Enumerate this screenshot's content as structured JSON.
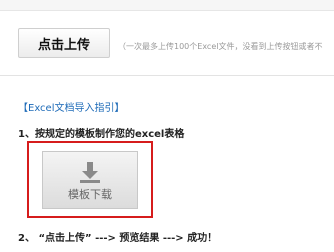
{
  "upload": {
    "button_label": "点击上传",
    "hint": "（一次最多上传100个Excel文件，没看到上传按钮或者不"
  },
  "guide": {
    "title": "【Excel文档导入指引】",
    "step1": "1、按规定的模板制作您的excel表格",
    "template_button": {
      "label": "模板下载",
      "icon": "download-icon"
    },
    "step2": "2、 “点击上传” ---> 预览结果 ---> 成功！"
  },
  "colors": {
    "highlight_border": "#d61c1c",
    "link_blue": "#1e6bb8"
  }
}
